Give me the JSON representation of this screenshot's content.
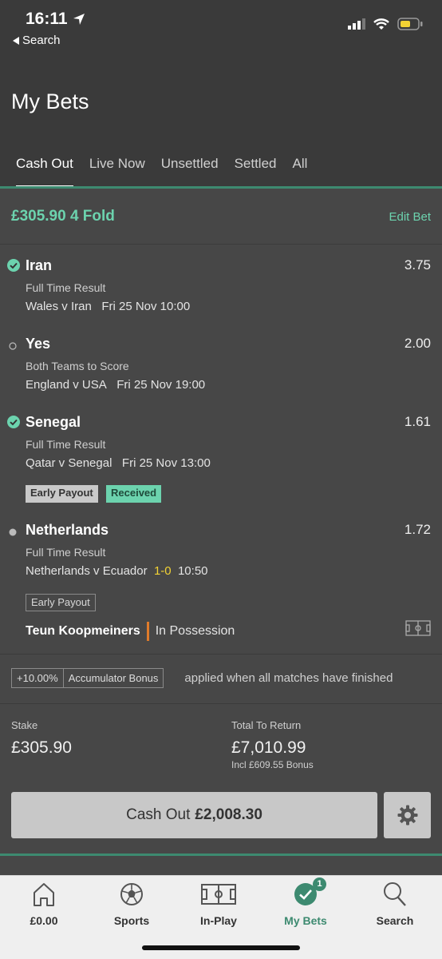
{
  "status_bar": {
    "time": "16:11",
    "back_label": "Search"
  },
  "header": {
    "title": "My Bets"
  },
  "tabs": [
    {
      "label": "Cash Out"
    },
    {
      "label": "Live Now"
    },
    {
      "label": "Unsettled"
    },
    {
      "label": "Settled"
    },
    {
      "label": "All"
    }
  ],
  "bet": {
    "summary": "£305.90 4 Fold",
    "edit_label": "Edit Bet",
    "selections": [
      {
        "name": "Iran",
        "odds": "3.75",
        "market": "Full Time Result",
        "match": "Wales v Iran",
        "date": "Fri 25 Nov 10:00",
        "status": "won"
      },
      {
        "name": "Yes",
        "odds": "2.00",
        "market": "Both Teams to Score",
        "match": "England v USA",
        "date": "Fri 25 Nov 19:00",
        "status": "pending"
      },
      {
        "name": "Senegal",
        "odds": "1.61",
        "market": "Full Time Result",
        "match": "Qatar v Senegal",
        "date": "Fri 25 Nov 13:00",
        "status": "won",
        "badges": [
          "Early Payout",
          "Received"
        ]
      },
      {
        "name": "Netherlands",
        "odds": "1.72",
        "market": "Full Time Result",
        "match": "Netherlands v Ecuador",
        "score": "1-0",
        "clock": "10:50",
        "status": "live",
        "badges": [
          "Early Payout"
        ]
      }
    ],
    "live_info": {
      "player": "Teun Koopmeiners",
      "state": "In Possession"
    },
    "bonus": {
      "percent": "+10.00%",
      "label": "Accumulator Bonus",
      "note": "applied when all matches have finished"
    },
    "stake_label": "Stake",
    "stake_value": "£305.90",
    "return_label": "Total To Return",
    "return_value": "£7,010.99",
    "return_bonus": "Incl £609.55 Bonus",
    "cashout_label": "Cash Out",
    "cashout_amount": "£2,008.30"
  },
  "bottom_nav": [
    {
      "label": "£0.00",
      "icon": "home-icon"
    },
    {
      "label": "Sports",
      "icon": "football-icon"
    },
    {
      "label": "In-Play",
      "icon": "pitch-icon"
    },
    {
      "label": "My Bets",
      "icon": "check-circle-icon",
      "badge": "1"
    },
    {
      "label": "Search",
      "icon": "search-icon"
    }
  ],
  "colors": {
    "accent": "#6cd3ae",
    "brand_green": "#3d8a70",
    "live_score": "#f2d234",
    "possession_bar": "#e07b2a"
  }
}
